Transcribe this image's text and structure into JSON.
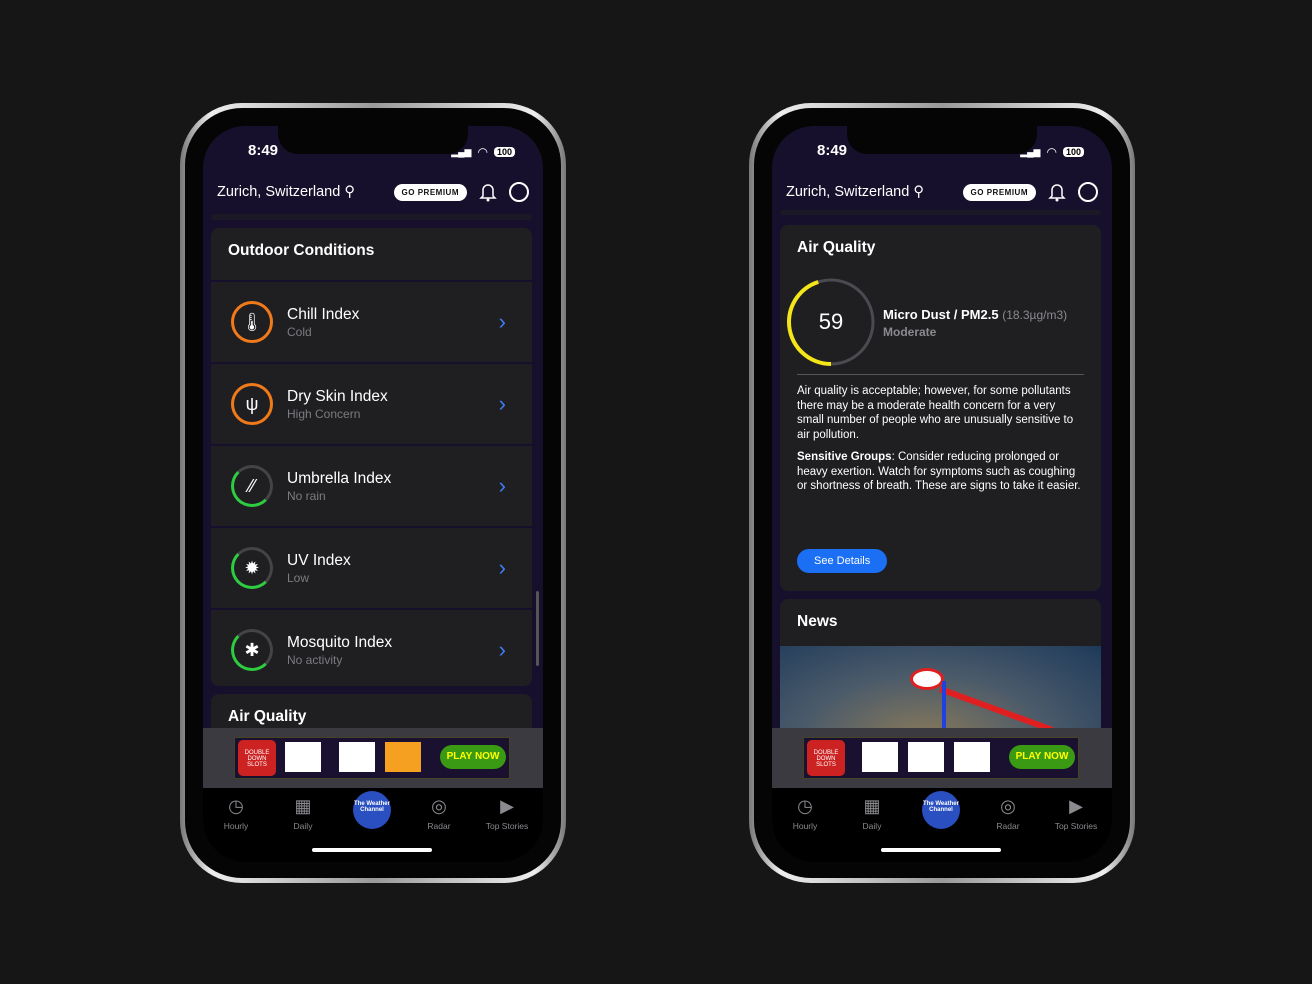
{
  "status": {
    "time": "8:49",
    "battery": "100"
  },
  "header": {
    "location": "Zurich, Switzerland",
    "premium": "GO PREMIUM"
  },
  "left": {
    "section_title": "Outdoor Conditions",
    "items": [
      {
        "name": "Chill Index",
        "status": "Cold",
        "icon": "thermometer",
        "color": "#f07a1a"
      },
      {
        "name": "Dry Skin Index",
        "status": "High Concern",
        "icon": "cactus",
        "color": "#f07a1a"
      },
      {
        "name": "Umbrella Index",
        "status": "No rain",
        "icon": "rain",
        "color": "#2ecc40"
      },
      {
        "name": "UV Index",
        "status": "Low",
        "icon": "sun",
        "color": "#2ecc40"
      },
      {
        "name": "Mosquito Index",
        "status": "No activity",
        "icon": "mosquito",
        "color": "#2ecc40"
      }
    ],
    "next_section": "Air Quality"
  },
  "right": {
    "aq_title": "Air Quality",
    "aq_value": "59",
    "aq_level": 0.45,
    "pollutant": "Micro Dust / PM2.5",
    "concentration": "(18.3µg/m3)",
    "category": "Moderate",
    "description": "Air quality is acceptable; however, for some pollutants there may be a moderate health concern for a very small number of people who are unusually sensitive to air pollution.",
    "sensitive_label": "Sensitive Groups",
    "sensitive_text": ": Consider reducing prolonged or heavy exertion. Watch for symptoms such as coughing or shortness of breath. These are signs to take it easier.",
    "details_button": "See Details",
    "news_title": "News"
  },
  "ad": {
    "cta": "PLAY NOW",
    "brand": "DOUBLE DOWN SLOTS"
  },
  "tabs": [
    "Hourly",
    "Daily",
    "The Weather Channel",
    "Radar",
    "Top Stories"
  ]
}
